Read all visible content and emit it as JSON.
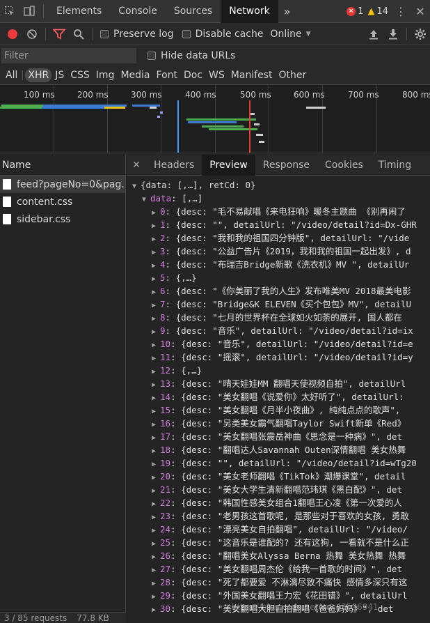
{
  "topbar": {
    "tabs": [
      "Elements",
      "Console",
      "Sources",
      "Network"
    ],
    "active_tab": "Network",
    "error_count": "1",
    "warning_count": "14"
  },
  "toolbar": {
    "preserve_log": "Preserve log",
    "disable_cache": "Disable cache",
    "throttle": "Online"
  },
  "filter": {
    "placeholder": "Filter",
    "hide_data_urls": "Hide data URLs"
  },
  "types": [
    "All",
    "XHR",
    "JS",
    "CSS",
    "Img",
    "Media",
    "Font",
    "Doc",
    "WS",
    "Manifest",
    "Other"
  ],
  "active_type": "XHR",
  "timeline": {
    "ticks": [
      "100 ms",
      "200 ms",
      "300 ms",
      "400 ms",
      "500 ms",
      "600 ms",
      "700 ms",
      "800 ms"
    ]
  },
  "requests": {
    "header": "Name",
    "items": [
      "feed?pageNo=0&pag...",
      "content.css",
      "sidebar.css"
    ],
    "status_requests": "3 / 85 requests",
    "status_size": "77.8 KB"
  },
  "detail": {
    "tabs": [
      "Headers",
      "Preview",
      "Response",
      "Cookies",
      "Timing"
    ],
    "active_tab": "Preview"
  },
  "preview": {
    "root": "{data: [,…], retCd: 0}",
    "data_key": "data",
    "data_summary": "[,…]",
    "items": [
      {
        "idx": "0",
        "text": "{desc: \"毛不易献唱《来电狂响》暖冬主题曲 《别再闹了"
      },
      {
        "idx": "1",
        "text": "{desc: \"\", detailUrl: \"/video/detail?id=Dx-GHR"
      },
      {
        "idx": "2",
        "text": "{desc: \"我和我的祖国四分钟版\", detailUrl: \"/vide"
      },
      {
        "idx": "3",
        "text": "{desc: \"公益广告片《2019，我和我的祖国一起出发》, d"
      },
      {
        "idx": "4",
        "text": "{desc: \"布瑞吉Bridge新歌《洗衣机》MV \", detailUr"
      },
      {
        "idx": "5",
        "text": "{,…}"
      },
      {
        "idx": "6",
        "text": "{desc: \"《你美丽了我的人生》发布唯美MV 2018最美电影"
      },
      {
        "idx": "7",
        "text": "{desc: \"Bridge&K ELEVEN《买个包包》MV\", detailU"
      },
      {
        "idx": "8",
        "text": "{desc: \"七月的世界杯在全球如火如荼的展开, 国人都在"
      },
      {
        "idx": "9",
        "text": "{desc: \"音乐\", detailUrl: \"/video/detail?id=ix"
      },
      {
        "idx": "10",
        "text": "{desc: \"音乐\", detailUrl: \"/video/detail?id=e"
      },
      {
        "idx": "11",
        "text": "{desc: \"摇滚\", detailUrl: \"/video/detail?id=y"
      },
      {
        "idx": "12",
        "text": "{,…}"
      },
      {
        "idx": "13",
        "text": "{desc: \"晴天娃娃MM 翻唱天使视频自拍\", detailUrl"
      },
      {
        "idx": "14",
        "text": "{desc: \"美女翻唱《说爱你》太好听了\", detailUrl: "
      },
      {
        "idx": "15",
        "text": "{desc: \"美女翻唱《月半小夜曲》, 纯纯点点的歌声\","
      },
      {
        "idx": "16",
        "text": "{desc: \"另类美女霸气翻唱Taylor Swift新单《Red》"
      },
      {
        "idx": "17",
        "text": "{desc: \"美女翻唱张震岳神曲《思念是一种病》\", det"
      },
      {
        "idx": "18",
        "text": "{desc: \"翻唱达人Savannah Outen深情翻唱 美女热舞"
      },
      {
        "idx": "19",
        "text": "{desc: \"\", detailUrl: \"/video/detail?id=wTg20"
      },
      {
        "idx": "20",
        "text": "{desc: \"美女老师翻唱《TikTok》潮爆课堂\", detail"
      },
      {
        "idx": "21",
        "text": "{desc: \"美女大学生清新翻唱范玮琪《黑白配》\", det"
      },
      {
        "idx": "22",
        "text": "{desc: \"韩国性感美女组合1翻唱王心凌《第一次爱的人"
      },
      {
        "idx": "23",
        "text": "{desc: \"老男孩这首歌呢, 是那些对于喜欢的女孩, 勇敢"
      },
      {
        "idx": "24",
        "text": "{desc: \"漂亮美女自拍翻唱\", detailUrl: \"/video/"
      },
      {
        "idx": "25",
        "text": "{desc: \"这音乐是谁配的? 还有这狗, 一看就不是什么正"
      },
      {
        "idx": "26",
        "text": "{desc: \"翻唱美女Alyssa Berna 热舞 美女热舞 热舞"
      },
      {
        "idx": "27",
        "text": "{desc: \"美女翻唱周杰伦《给我一首歌的时间》\", det"
      },
      {
        "idx": "28",
        "text": "{desc: \"死了都要爱 不淋漓尽致不痛快 感情多深只有这"
      },
      {
        "idx": "29",
        "text": "{desc: \"外国美女翻唱王力宏《花田错》\", detailUrl"
      },
      {
        "idx": "30",
        "text": "{desc: \"美女翻唱大胆自拍翻唱《爸爸妈妈》\", det"
      }
    ]
  },
  "watermark": "https://blog.csdn.net/qq_43596941"
}
